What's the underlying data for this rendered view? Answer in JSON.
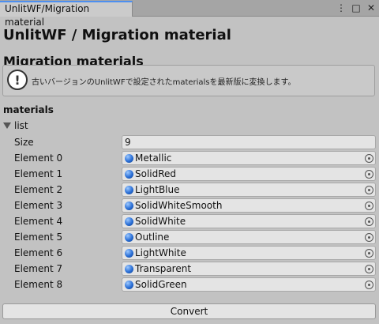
{
  "window": {
    "tab_title": "UnlitWF/Migration material",
    "menu_icon": "⋮",
    "maximize_icon": "□",
    "close_icon": "✕"
  },
  "header": {
    "title": "UnlitWF / Migration material",
    "subtitle": "Migration materials"
  },
  "help": {
    "icon": "!",
    "text": "古いバージョンのUnlitWFで設定されたmaterialsを最新版に変換します。"
  },
  "materials": {
    "label": "materials",
    "list_label": "list",
    "size_label": "Size",
    "size_value": "9",
    "elements": [
      {
        "label": "Element 0",
        "value": "Metallic"
      },
      {
        "label": "Element 1",
        "value": "SolidRed"
      },
      {
        "label": "Element 2",
        "value": "LightBlue"
      },
      {
        "label": "Element 3",
        "value": "SolidWhiteSmooth"
      },
      {
        "label": "Element 4",
        "value": "SolidWhite"
      },
      {
        "label": "Element 5",
        "value": "Outline"
      },
      {
        "label": "Element 6",
        "value": "LightWhite"
      },
      {
        "label": "Element 7",
        "value": "Transparent"
      },
      {
        "label": "Element 8",
        "value": "SolidGreen"
      }
    ]
  },
  "actions": {
    "convert_label": "Convert"
  },
  "colors": {
    "background": "#c2c2c2",
    "tab_accent": "#4d8ff0",
    "field_background": "#e4e4e4",
    "material_icon": "#2a6fd6"
  }
}
